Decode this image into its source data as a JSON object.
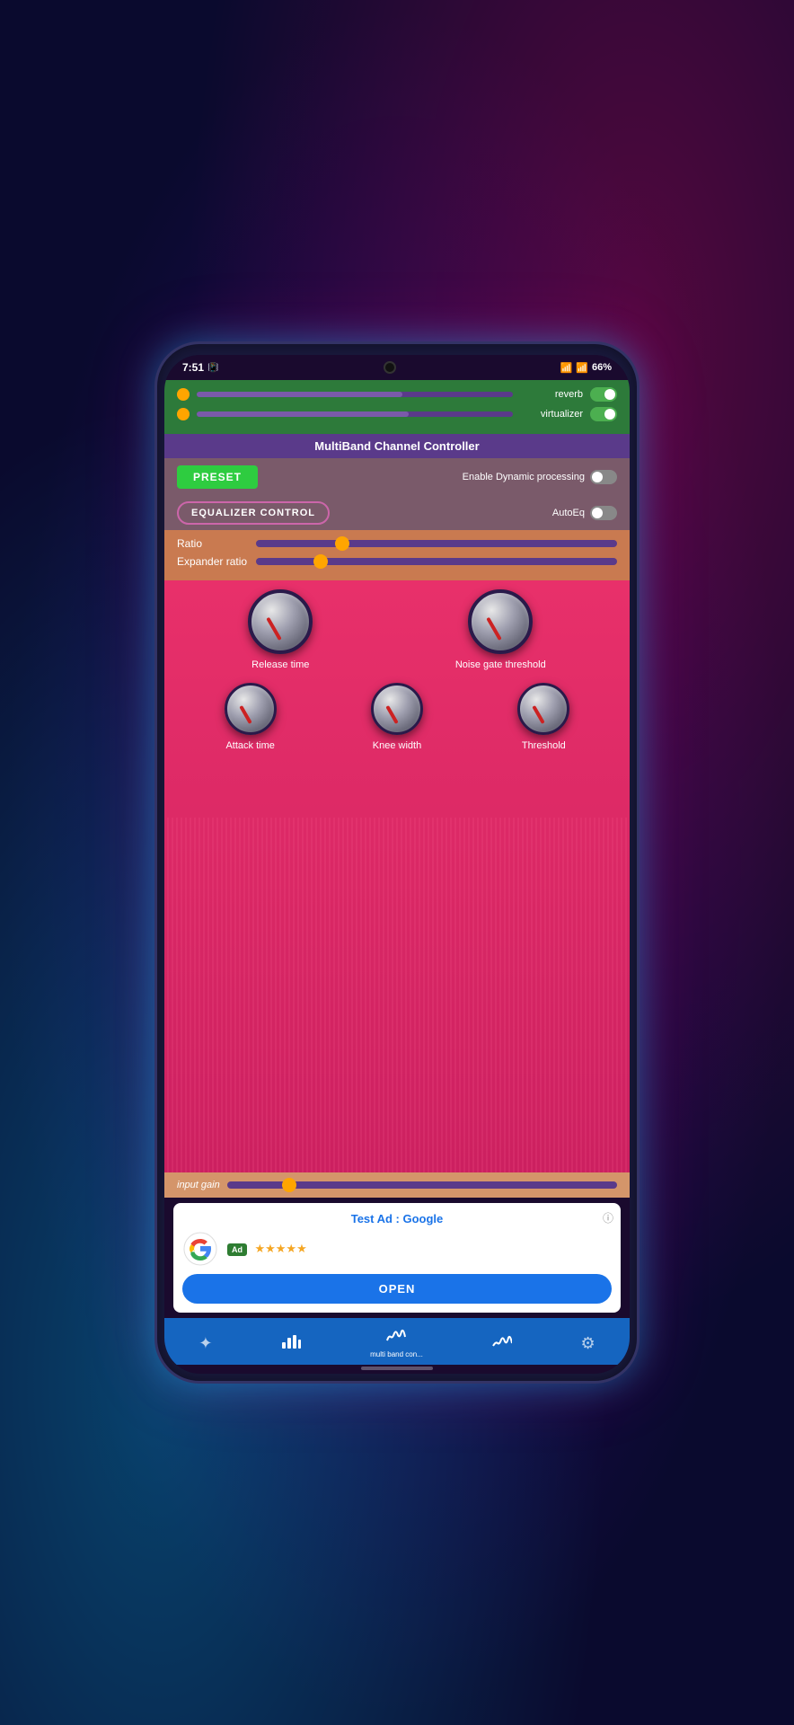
{
  "status": {
    "time": "7:51",
    "battery": "66%"
  },
  "app": {
    "title": "MultiBand Channel Controller",
    "reverb_label": "reverb",
    "virtualizer_label": "virtualizer",
    "preset_label": "PRESET",
    "enable_dynamic_label": "Enable Dynamic processing",
    "eq_control_label": "EQUALIZER CONTROL",
    "autoeq_label": "AutoEq",
    "ratio_label": "Ratio",
    "expander_ratio_label": "Expander ratio",
    "knobs": {
      "release_time": "Release time",
      "noise_gate": "Noise gate threshold",
      "attack_time": "Attack time",
      "knee_width": "Knee width",
      "threshold": "Threshold"
    },
    "input_gain_label": "input gain"
  },
  "ad": {
    "title": "Test Ad : Google",
    "badge": "Ad",
    "open_label": "OPEN",
    "stars": "★★★★★"
  },
  "nav": {
    "items": [
      {
        "icon": "✦",
        "label": ""
      },
      {
        "icon": "▊▊▊",
        "label": ""
      },
      {
        "icon": "≋≋≋",
        "label": "multi band con..."
      },
      {
        "icon": "≈≈≈",
        "label": ""
      },
      {
        "icon": "⚠",
        "label": ""
      }
    ]
  }
}
